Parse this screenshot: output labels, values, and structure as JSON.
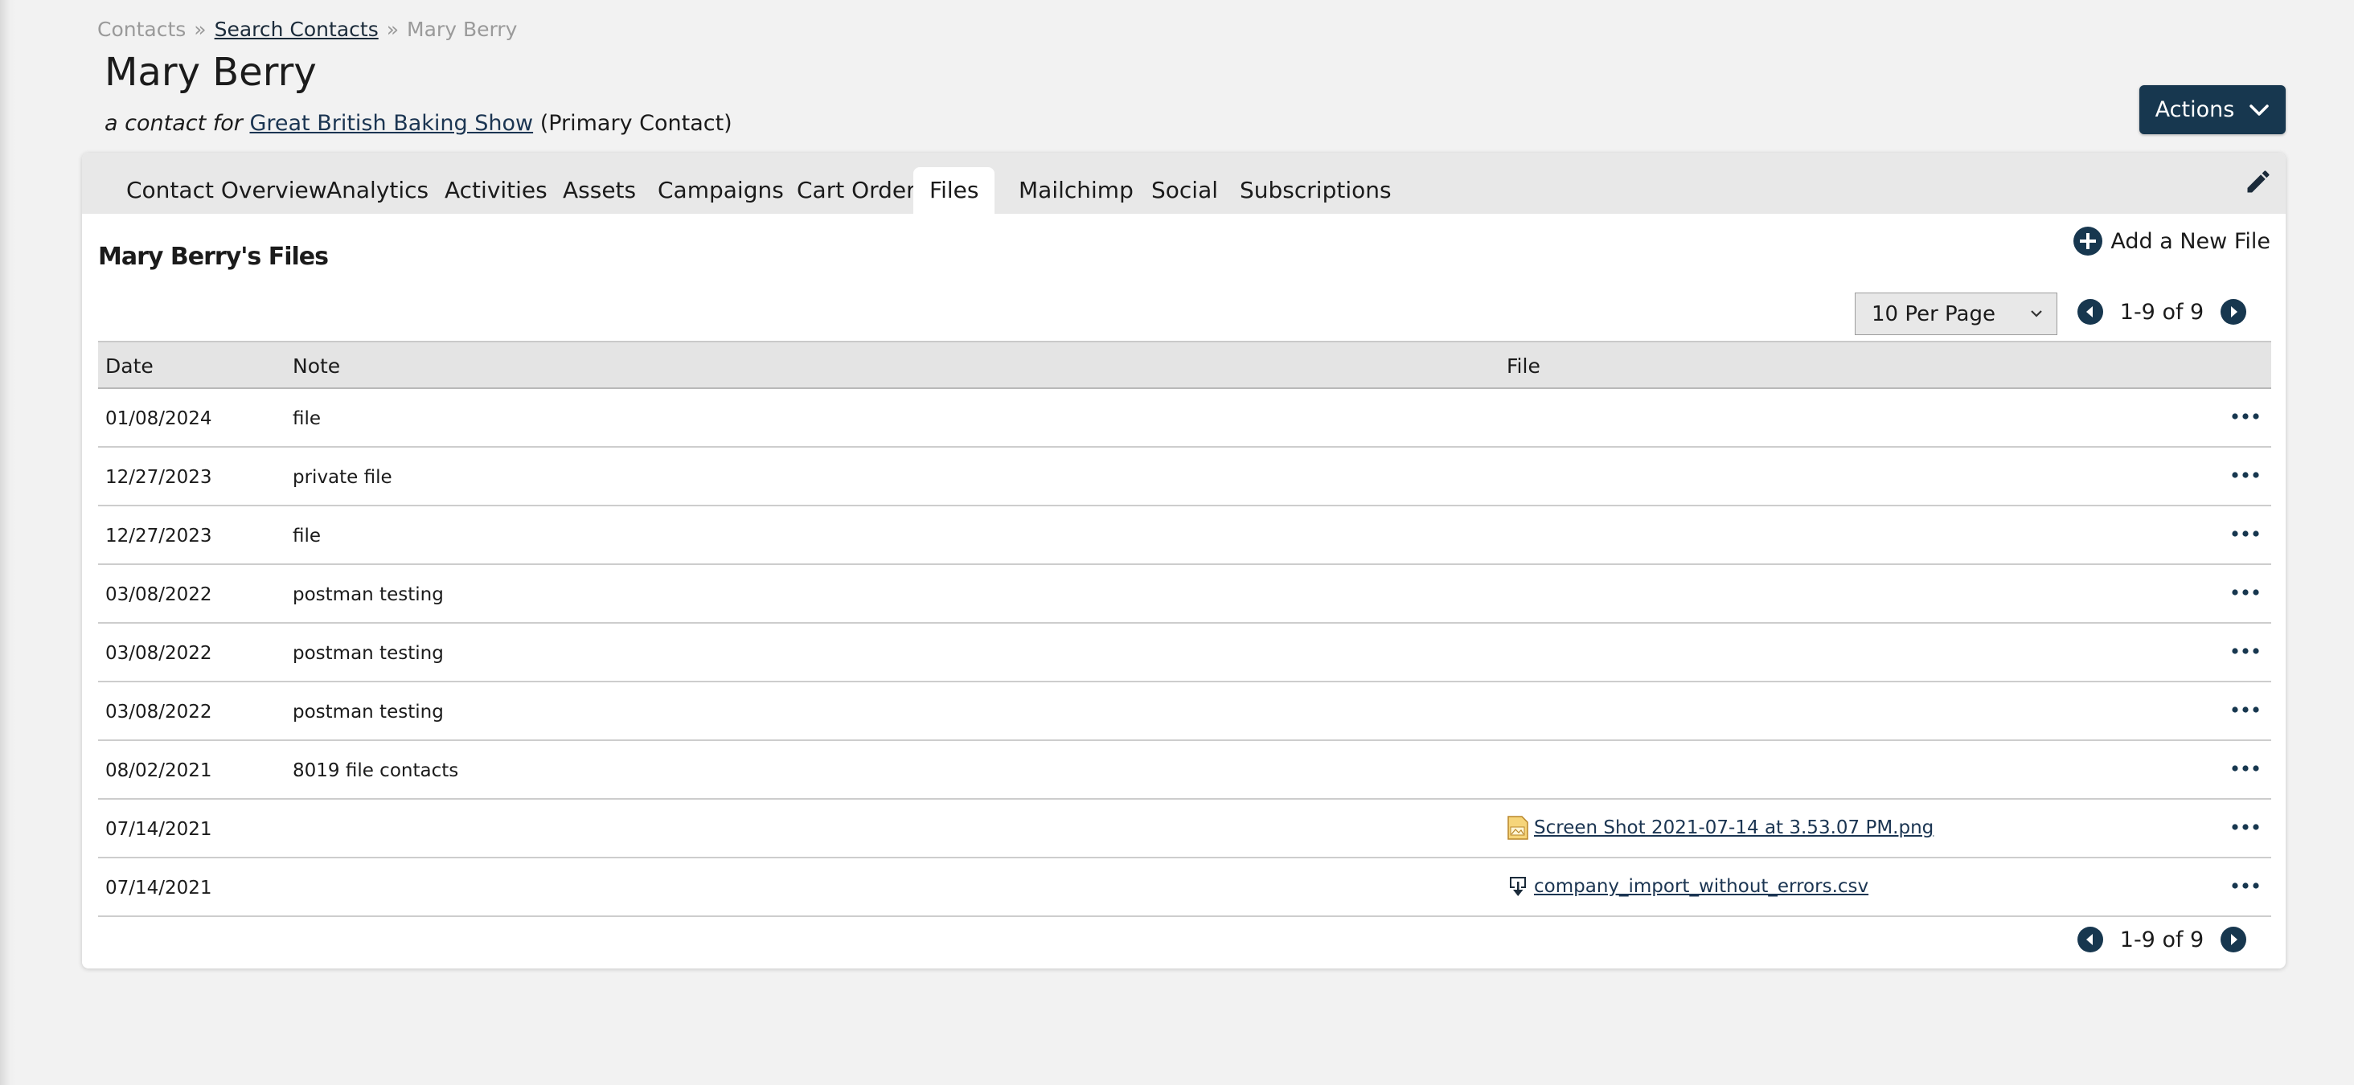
{
  "breadcrumb": {
    "root": "Contacts",
    "separator": "»",
    "link": "Search Contacts",
    "current": "Mary Berry"
  },
  "page_title": "Mary Berry",
  "subtitle": {
    "prefix": "a contact for",
    "company_link": "Great British Baking Show",
    "suffix": "(Primary Contact)"
  },
  "actions_button": {
    "label": "Actions",
    "icon": "chevron-down-icon"
  },
  "tabs": [
    {
      "label": "Contact Overview"
    },
    {
      "label": "Analytics"
    },
    {
      "label": "Activities"
    },
    {
      "label": "Assets"
    },
    {
      "label": "Campaigns"
    },
    {
      "label": "Cart Orders"
    },
    {
      "label": "Files",
      "active": true
    },
    {
      "label": "Mailchimp"
    },
    {
      "label": "Social"
    },
    {
      "label": "Subscriptions"
    }
  ],
  "files_section": {
    "title": "Mary Berry's Files",
    "add_label": "Add a New File",
    "per_page": "10 Per Page",
    "pagination": "1-9 of 9"
  },
  "table": {
    "columns": [
      "Date",
      "Note",
      "File"
    ],
    "rows": [
      {
        "date": "01/08/2024",
        "note": "file",
        "file": ""
      },
      {
        "date": "12/27/2023",
        "note": "private file",
        "file": ""
      },
      {
        "date": "12/27/2023",
        "note": "file",
        "file": ""
      },
      {
        "date": "03/08/2022",
        "note": "postman testing",
        "file": ""
      },
      {
        "date": "03/08/2022",
        "note": "postman testing",
        "file": ""
      },
      {
        "date": "03/08/2022",
        "note": "postman testing",
        "file": ""
      },
      {
        "date": "08/02/2021",
        "note": "8019 file contacts",
        "file": ""
      },
      {
        "date": "07/14/2021",
        "note": "",
        "file": "Screen Shot 2021-07-14 at 3.53.07 PM.png",
        "file_icon": "image-file-icon"
      },
      {
        "date": "07/14/2021",
        "note": "",
        "file": "company_import_without_errors.csv",
        "file_icon": "download-file-icon"
      }
    ]
  },
  "colors": {
    "primary": "#17374f",
    "link": "#1b3552",
    "tabbar": "#e8e8e8",
    "page_bg": "#f2f2f2"
  }
}
